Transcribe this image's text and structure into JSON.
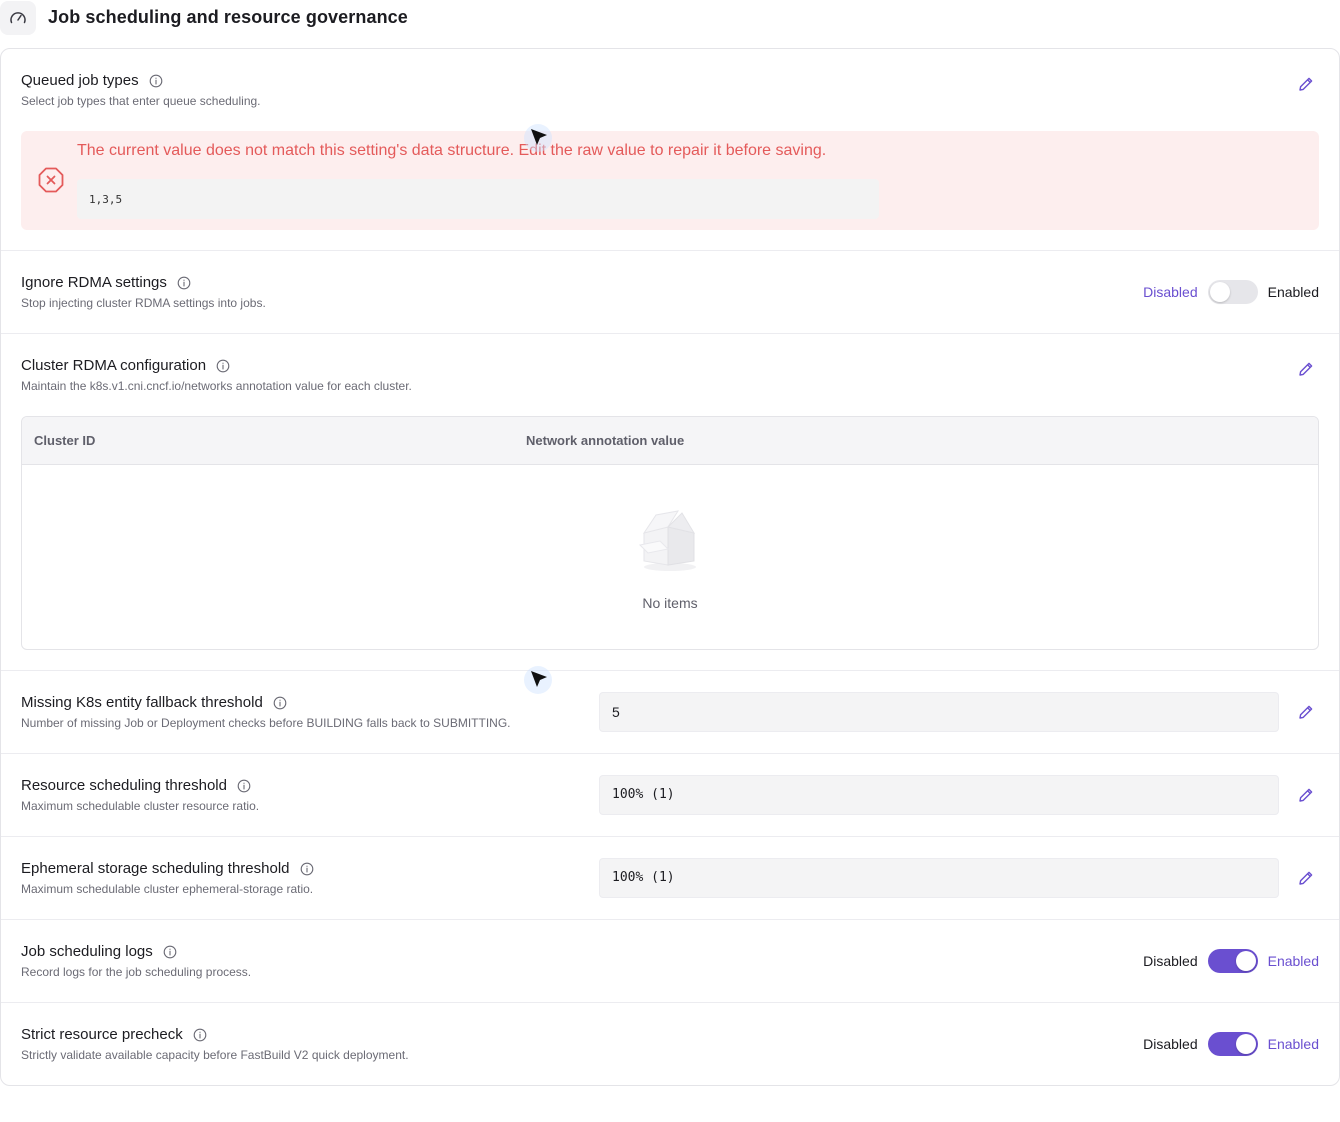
{
  "header": {
    "title": "Job scheduling and resource governance",
    "icon": "gauge-icon"
  },
  "queued_job_types": {
    "label": "Queued job types",
    "description": "Select job types that enter queue scheduling.",
    "error_message": "The current value does not match this setting's data structure. Edit the raw value to repair it before saving.",
    "raw_value": "1,3,5"
  },
  "ignore_rdma": {
    "label": "Ignore RDMA settings",
    "description": "Stop injecting cluster RDMA settings into jobs.",
    "off_label": "Disabled",
    "on_label": "Enabled",
    "enabled": false
  },
  "cluster_rdma": {
    "label": "Cluster RDMA configuration",
    "description": "Maintain the k8s.v1.cni.cncf.io/networks annotation value for each cluster.",
    "columns": [
      "Cluster ID",
      "Network annotation value"
    ],
    "rows": [],
    "empty_text": "No items"
  },
  "missing_k8s": {
    "label": "Missing K8s entity fallback threshold",
    "description": "Number of missing Job or Deployment checks before BUILDING falls back to SUBMITTING.",
    "value": "5"
  },
  "resource_threshold": {
    "label": "Resource scheduling threshold",
    "description": "Maximum schedulable cluster resource ratio.",
    "value": "100% (1)"
  },
  "ephemeral_threshold": {
    "label": "Ephemeral storage scheduling threshold",
    "description": "Maximum schedulable cluster ephemeral-storage ratio.",
    "value": "100% (1)"
  },
  "scheduling_logs": {
    "label": "Job scheduling logs",
    "description": "Record logs for the job scheduling process.",
    "off_label": "Disabled",
    "on_label": "Enabled",
    "enabled": true
  },
  "strict_precheck": {
    "label": "Strict resource precheck",
    "description": "Strictly validate available capacity before FastBuild V2 quick deployment.",
    "off_label": "Disabled",
    "on_label": "Enabled",
    "enabled": true
  },
  "colors": {
    "accent": "#6a4fd0",
    "error": "#e45a5a",
    "error_bg": "#fdeeee"
  }
}
